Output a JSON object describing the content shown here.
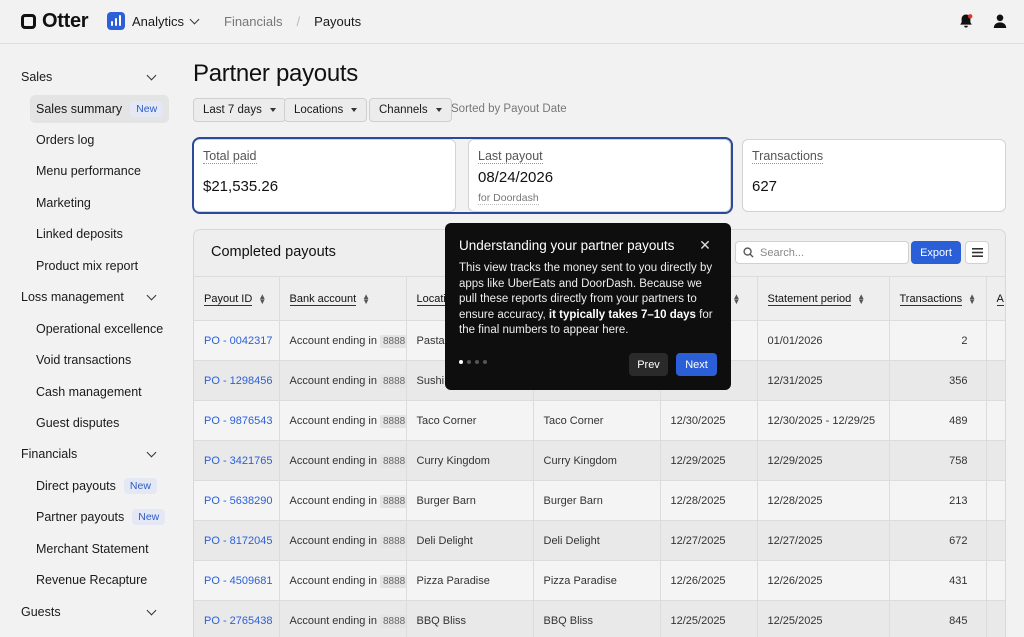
{
  "brand": {
    "name": "Otter"
  },
  "app_switcher": {
    "label": "Analytics"
  },
  "breadcrumb": {
    "parent": "Financials",
    "separator": "/",
    "current": "Payouts"
  },
  "icons": {
    "notifications": "bell-icon",
    "account": "user-icon",
    "search": "search-icon",
    "menu": "list-icon",
    "close": "close-icon"
  },
  "colors": {
    "accent": "#2b5fd8",
    "popover_bg": "#0e0e0e",
    "badge_text": "#2d5cc7",
    "focus_ring": "#2c4a9a"
  },
  "sidebar": {
    "sections": [
      {
        "title": "Sales",
        "items": [
          {
            "label": "Sales summary",
            "badge": "New",
            "active": true
          },
          {
            "label": "Orders log"
          },
          {
            "label": "Menu performance"
          },
          {
            "label": "Marketing"
          },
          {
            "label": "Linked deposits"
          },
          {
            "label": "Product mix report"
          }
        ]
      },
      {
        "title": "Loss management",
        "items": [
          {
            "label": "Operational excellence"
          },
          {
            "label": "Void transactions"
          },
          {
            "label": "Cash management"
          },
          {
            "label": "Guest disputes"
          }
        ]
      },
      {
        "title": "Financials",
        "items": [
          {
            "label": "Direct payouts",
            "badge": "New"
          },
          {
            "label": "Partner payouts",
            "badge": "New"
          },
          {
            "label": "Merchant Statement"
          },
          {
            "label": "Revenue Recapture"
          }
        ]
      },
      {
        "title": "Guests",
        "items": []
      }
    ]
  },
  "page": {
    "title": "Partner payouts",
    "filters": {
      "date": "Last 7 days",
      "locations": "Locations",
      "channels": "Channels",
      "sorted_by": "Sorted by Payout Date"
    }
  },
  "summary": {
    "total_paid": {
      "label": "Total paid",
      "value": "$21,535.26"
    },
    "last_payout": {
      "label": "Last payout",
      "value": "08/24/2026",
      "sub": "for Doordash"
    },
    "transactions": {
      "label": "Transactions",
      "value": "627"
    }
  },
  "completed": {
    "title": "Completed payouts",
    "search_placeholder": "Search...",
    "export_label": "Export",
    "columns": [
      "Payout ID",
      "Bank account",
      "Locati",
      "",
      "",
      "Statement period",
      "Transactions",
      "A"
    ],
    "rows": [
      {
        "id": "PO - 0042317",
        "bank": "Account ending in",
        "mask": "8888",
        "location": "Pasta",
        "store": "",
        "date": "",
        "period": "01/01/2026",
        "tx": "2"
      },
      {
        "id": "PO - 1298456",
        "bank": "Account ending in",
        "mask": "8888",
        "location": "Sushi",
        "store": "",
        "date": "",
        "period": "12/31/2025",
        "tx": "356"
      },
      {
        "id": "PO - 9876543",
        "bank": "Account ending in",
        "mask": "8888",
        "location": "Taco Corner",
        "store": "Taco Corner",
        "date": "12/30/2025",
        "period": "12/30/2025 - 12/29/25",
        "tx": "489"
      },
      {
        "id": "PO - 3421765",
        "bank": "Account ending in",
        "mask": "8888",
        "location": "Curry Kingdom",
        "store": "Curry Kingdom",
        "date": "12/29/2025",
        "period": "12/29/2025",
        "tx": "758"
      },
      {
        "id": "PO - 5638290",
        "bank": "Account ending in",
        "mask": "8888",
        "location": "Burger Barn",
        "store": "Burger Barn",
        "date": "12/28/2025",
        "period": "12/28/2025",
        "tx": "213"
      },
      {
        "id": "PO - 8172045",
        "bank": "Account ending in",
        "mask": "8888",
        "location": "Deli Delight",
        "store": "Deli Delight",
        "date": "12/27/2025",
        "period": "12/27/2025",
        "tx": "672"
      },
      {
        "id": "PO - 4509681",
        "bank": "Account ending in",
        "mask": "8888",
        "location": "Pizza Paradise",
        "store": "Pizza Paradise",
        "date": "12/26/2025",
        "period": "12/26/2025",
        "tx": "431"
      },
      {
        "id": "PO - 2765438",
        "bank": "Account ending in",
        "mask": "8888",
        "location": "BBQ Bliss",
        "store": "BBQ Bliss",
        "date": "12/25/2025",
        "period": "12/25/2025",
        "tx": "845"
      }
    ]
  },
  "tour": {
    "title": "Understanding your partner payouts",
    "body_1": "This view tracks the money sent to you directly by apps like UberEats and DoorDash. Because we pull these reports directly from your partners to ensure accuracy, ",
    "body_bold": "it typically takes 7–10 days",
    "body_2": " for the final numbers to appear here.",
    "prev_label": "Prev",
    "next_label": "Next",
    "step": 1,
    "steps": 4
  }
}
